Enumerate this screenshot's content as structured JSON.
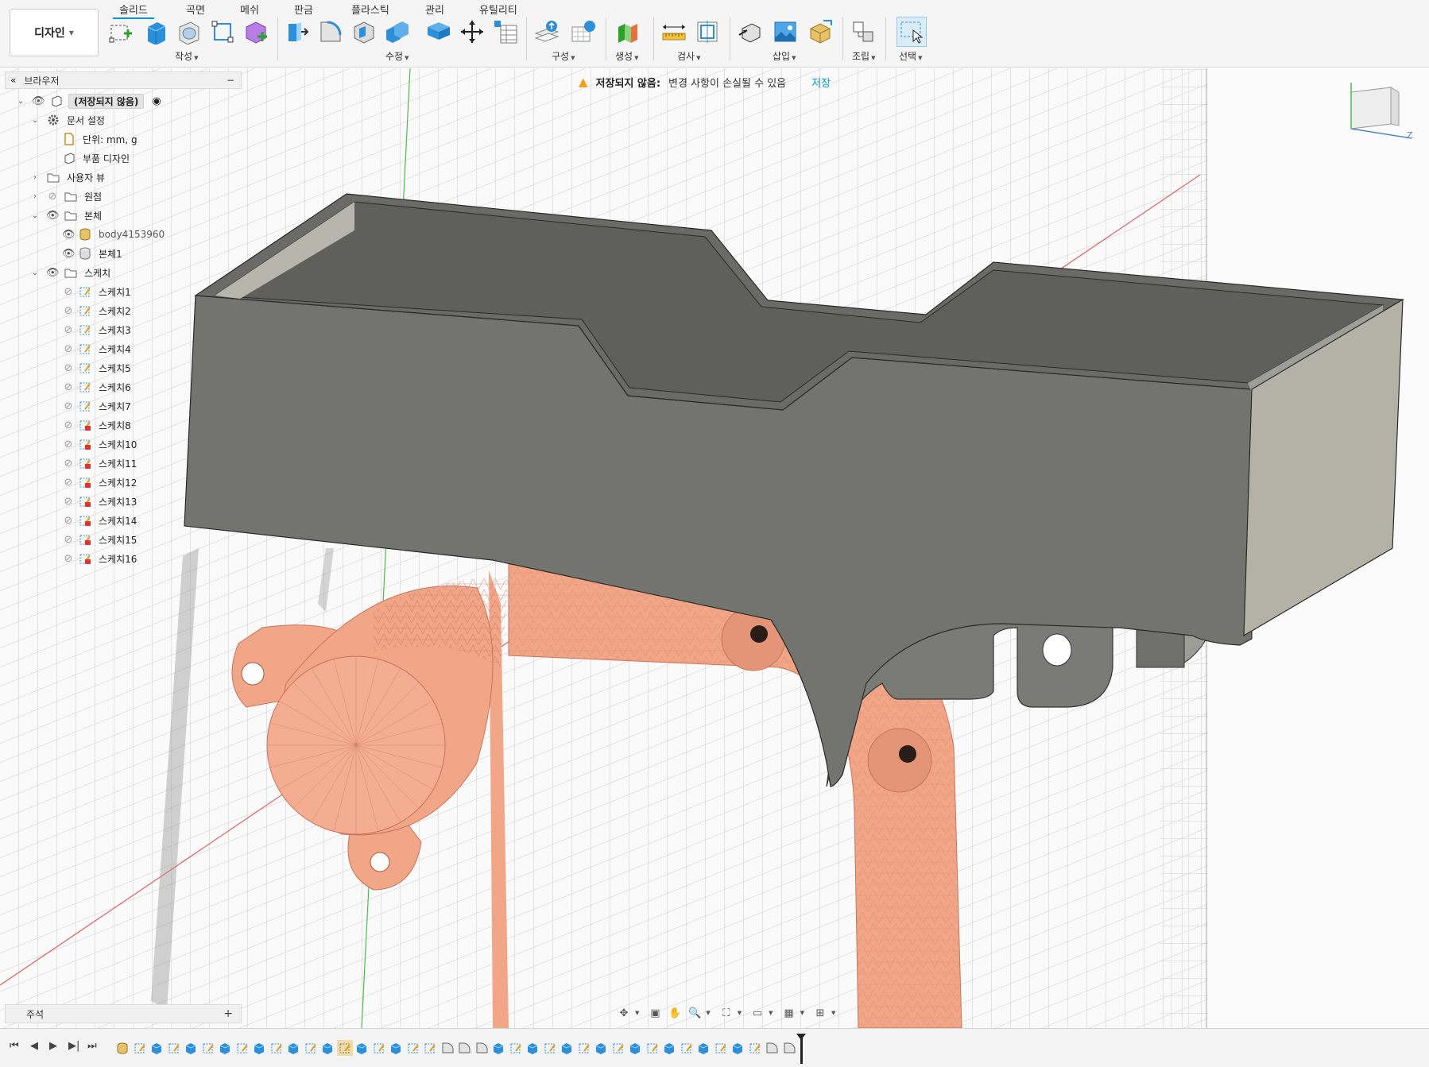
{
  "workspace": {
    "label": "디자인"
  },
  "tabs": [
    "솔리드",
    "곡면",
    "메쉬",
    "판금",
    "플라스틱",
    "관리",
    "유틸리티"
  ],
  "tool_groups": [
    "작성",
    "수정",
    "구성",
    "생성",
    "검사",
    "삽입",
    "조립",
    "선택"
  ],
  "banner": {
    "title": "저장되지 않음:",
    "message": "변경 사항이 손실될 수 있음",
    "action": "저장"
  },
  "browser": {
    "title": "브라우저",
    "root": "(저장되지 않음)",
    "doc_settings": "문서 설정",
    "units": "단위: mm, g",
    "component_design": "부품 디자인",
    "named_views": "사용자 뷰",
    "origin": "원점",
    "bodies": "본체",
    "body_mesh": "body4153960",
    "body_solid": "본체1",
    "sketches": "스케치",
    "sketch_items": [
      "스케치1",
      "스케치2",
      "스케치3",
      "스케치4",
      "스케치5",
      "스케치6",
      "스케치7",
      "스케치8",
      "스케치10",
      "스케치11",
      "스케치12",
      "스케치13",
      "스케치14",
      "스케치15",
      "스케치16"
    ]
  },
  "notes": {
    "title": "주석"
  },
  "colors": {
    "accent": "#0696d7",
    "warning": "#f0a01b",
    "solid_body": "#73746f",
    "mesh_body": "#f2a688",
    "grid": "#c9c9c9"
  }
}
